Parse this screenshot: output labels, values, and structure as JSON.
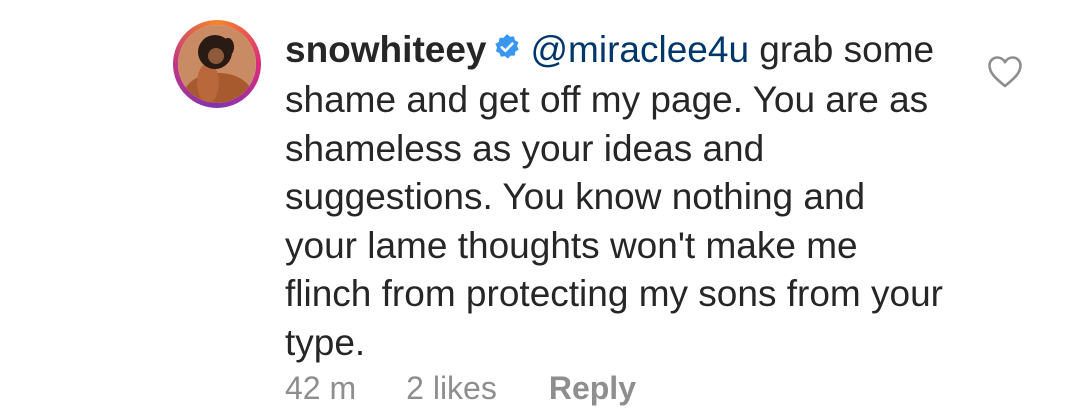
{
  "comment": {
    "username": "snowhiteey",
    "verified": true,
    "mention": "@miraclee4u",
    "text": " grab some shame and get off my page. You are as shameless as your ideas and suggestions.  You know nothing and your lame thoughts won't make me flinch from protecting my sons from your type.",
    "time": "42 m",
    "likes": "2 likes",
    "reply_label": "Reply"
  },
  "icons": {
    "verified": "verified-badge-icon",
    "like": "heart-outline-icon"
  },
  "colors": {
    "text": "#262626",
    "mention": "#00376b",
    "meta": "#8e8e8e",
    "verified": "#3897f0"
  }
}
